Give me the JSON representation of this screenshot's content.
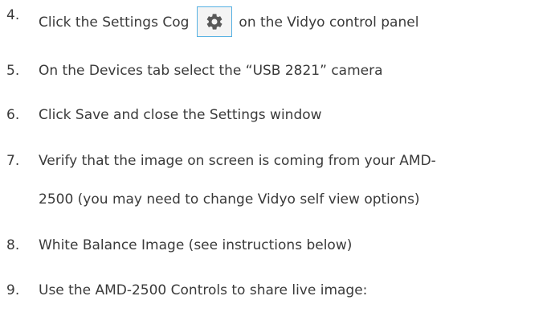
{
  "steps": [
    {
      "number": "4.",
      "before_icon": "Click the Settings Cog",
      "icon": "gear-icon",
      "after_icon": "on the Vidyo control panel"
    },
    {
      "number": "5.",
      "text": "On the Devices tab  select the “USB 2821” camera"
    },
    {
      "number": "6.",
      "text": "Click Save and close the Settings window"
    },
    {
      "number": "7.",
      "line1": "Verify that the image on screen is coming from your AMD-",
      "line2": "2500 (you may need to change Vidyo self view options)"
    },
    {
      "number": "8.",
      "text": "White Balance Image (see instructions below)"
    },
    {
      "number": "9.",
      "text": "Use the AMD-2500 Controls to share live image:"
    }
  ],
  "colors": {
    "text": "#3a3a3a",
    "icon_border": "#56b1e3",
    "icon_background": "#f4f4f4",
    "icon_glyph": "#595959"
  }
}
